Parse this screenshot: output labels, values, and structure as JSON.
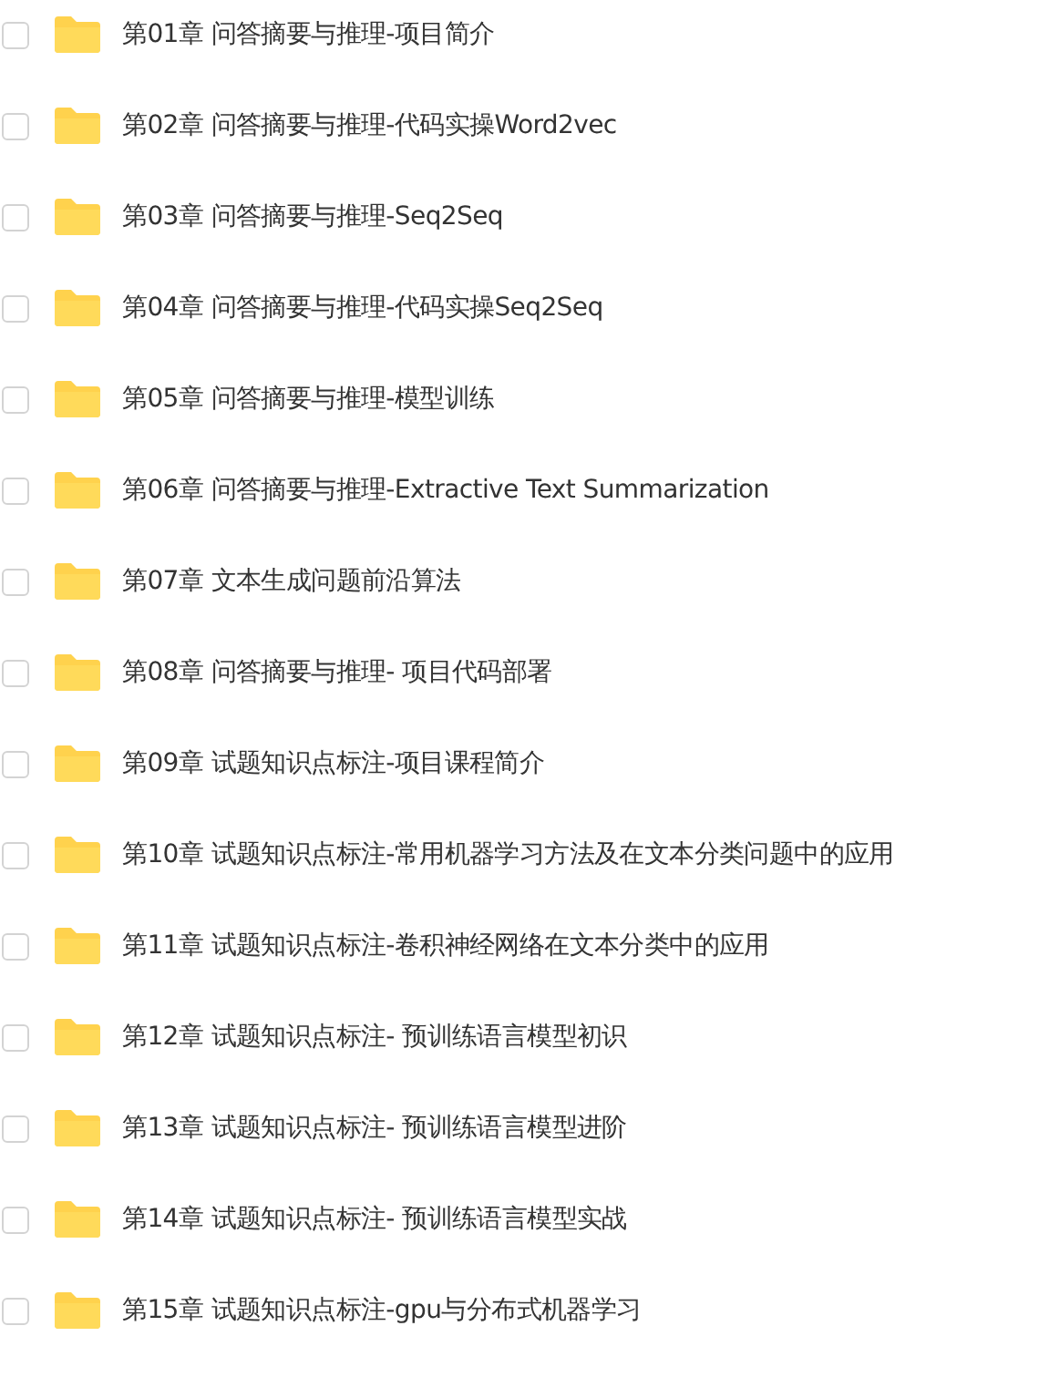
{
  "folders": [
    {
      "name": "第01章 问答摘要与推理-项目简介",
      "checked": false
    },
    {
      "name": "第02章 问答摘要与推理-代码实操Word2vec",
      "checked": false
    },
    {
      "name": "第03章 问答摘要与推理-Seq2Seq",
      "checked": false
    },
    {
      "name": "第04章 问答摘要与推理-代码实操Seq2Seq",
      "checked": false
    },
    {
      "name": "第05章 问答摘要与推理-模型训练",
      "checked": false
    },
    {
      "name": "第06章 问答摘要与推理-Extractive Text Summarization",
      "checked": false
    },
    {
      "name": "第07章 文本生成问题前沿算法",
      "checked": false
    },
    {
      "name": "第08章 问答摘要与推理- 项目代码部署",
      "checked": false
    },
    {
      "name": "第09章 试题知识点标注-项目课程简介",
      "checked": false
    },
    {
      "name": "第10章 试题知识点标注-常用机器学习方法及在文本分类问题中的应用",
      "checked": false
    },
    {
      "name": "第11章 试题知识点标注-卷积神经网络在文本分类中的应用",
      "checked": false
    },
    {
      "name": "第12章 试题知识点标注- 预训练语言模型初识",
      "checked": false
    },
    {
      "name": "第13章 试题知识点标注- 预训练语言模型进阶",
      "checked": false
    },
    {
      "name": "第14章 试题知识点标注- 预训练语言模型实战",
      "checked": false
    },
    {
      "name": "第15章 试题知识点标注-gpu与分布式机器学习",
      "checked": false
    }
  ]
}
